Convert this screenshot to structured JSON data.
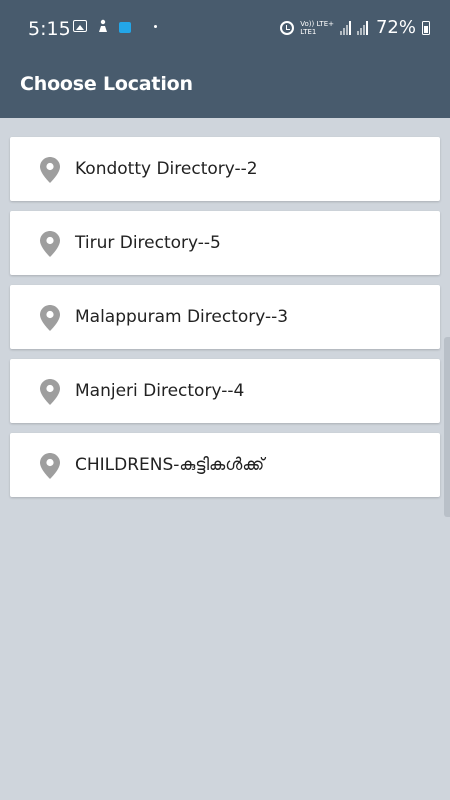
{
  "status_bar": {
    "time": "5:15",
    "volte_line1": "Vo)) LTE+",
    "volte_line2": "LTE1",
    "battery_percent": "72%",
    "accent_blue": "#23a6e8",
    "icons": [
      "gallery-icon",
      "figure-icon",
      "shopping-bag-icon",
      "dot-icon",
      "alarm-icon",
      "signal-icon",
      "battery-icon"
    ]
  },
  "header": {
    "title": "Choose Location",
    "background_color": "#485b6d"
  },
  "locations": [
    {
      "label": "Kondotty Directory--2",
      "icon": "location-pin-icon"
    },
    {
      "label": "Tirur Directory--5",
      "icon": "location-pin-icon"
    },
    {
      "label": "Malappuram Directory--3",
      "icon": "location-pin-icon"
    },
    {
      "label": "Manjeri Directory--4",
      "icon": "location-pin-icon"
    },
    {
      "label": "CHILDRENS-കുട്ടികൾക്ക്",
      "icon": "location-pin-icon"
    }
  ],
  "colors": {
    "page_background": "#cfd5dc",
    "card_background": "#ffffff",
    "pin_color": "#9e9e9e"
  }
}
